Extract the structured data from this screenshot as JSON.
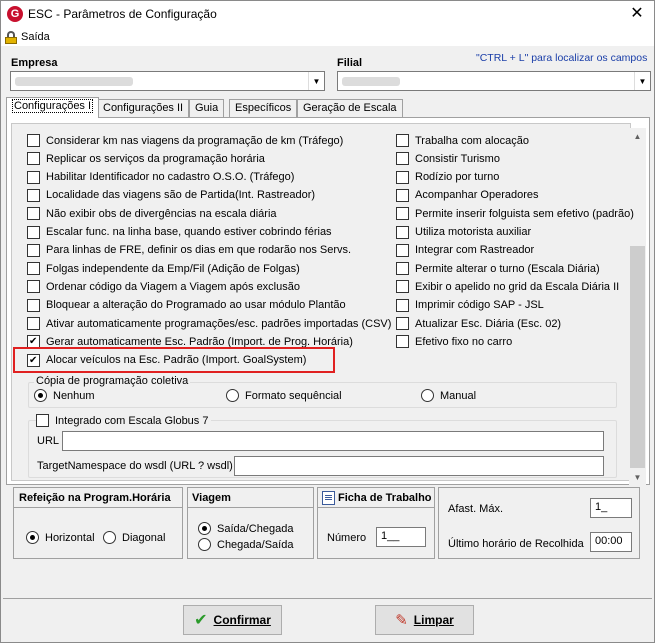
{
  "window": {
    "title": "ESC - Parâmetros de Configuração",
    "logo_letter": "G",
    "close_glyph": "✕"
  },
  "menu": {
    "sair": "Saída"
  },
  "empresa": {
    "label": "Empresa"
  },
  "filial": {
    "label": "Filial"
  },
  "hint": "\"CTRL + L\" para localizar os campos",
  "tabs": [
    {
      "label": "Configurações I"
    },
    {
      "label": "Configurações II"
    },
    {
      "label": "Guia"
    },
    {
      "label": "Específicos"
    },
    {
      "label": "Geração de Escala"
    }
  ],
  "left_options": [
    {
      "label": "Considerar km nas viagens da programação de km (Tráfego)",
      "checked": false
    },
    {
      "label": "Replicar os serviços da programação horária",
      "checked": false
    },
    {
      "label": "Habilitar Identificador no cadastro O.S.O. (Tráfego)",
      "checked": false
    },
    {
      "label": "Localidade das viagens são de Partida(Int. Rastreador)",
      "checked": false
    },
    {
      "label": "Não exibir obs de divergências na escala diária",
      "checked": false
    },
    {
      "label": "Escalar func. na linha base, quando estiver cobrindo férias",
      "checked": false
    },
    {
      "label": "Para linhas de FRE, definir os dias em que rodarão nos Servs.",
      "checked": false
    },
    {
      "label": "Folgas independente da Emp/Fil (Adição de Folgas)",
      "checked": false
    },
    {
      "label": "Ordenar código da Viagem a Viagem após exclusão",
      "checked": false
    },
    {
      "label": "Bloquear a alteração do Programado ao usar módulo Plantão",
      "checked": false
    },
    {
      "label": "Ativar automaticamente programações/esc. padrões importadas (CSV)",
      "checked": false
    },
    {
      "label": "Gerar automaticamente Esc. Padrão (Import. de Prog. Horária)",
      "checked": true
    },
    {
      "label": "Alocar veículos na Esc. Padrão (Import. GoalSystem)",
      "checked": true
    }
  ],
  "right_options": [
    {
      "label": "Trabalha com alocação",
      "checked": false
    },
    {
      "label": "Consistir Turismo",
      "checked": false
    },
    {
      "label": "Rodízio por turno",
      "checked": false
    },
    {
      "label": "Acompanhar Operadores",
      "checked": false
    },
    {
      "label": "Permite inserir folguista sem efetivo (padrão)",
      "checked": false
    },
    {
      "label": "Utiliza motorista auxiliar",
      "checked": false
    },
    {
      "label": "Integrar com Rastreador",
      "checked": false
    },
    {
      "label": "Permite alterar o turno (Escala Diária)",
      "checked": false
    },
    {
      "label": "Exibir o apelido no grid da Escala Diária II",
      "checked": false
    },
    {
      "label": "Imprimir código SAP - JSL",
      "checked": false
    },
    {
      "label": "Atualizar Esc. Diária (Esc. 02)",
      "checked": false
    },
    {
      "label": "Efetivo fixo no carro",
      "checked": false
    }
  ],
  "copia": {
    "title": "Cópia de programação coletiva",
    "options": [
      "Nenhum",
      "Formato sequêncial",
      "Manual"
    ],
    "selected": "Nenhum"
  },
  "globus": {
    "title": "Integrado com Escala Globus 7",
    "checked": false,
    "url_label": "URL",
    "url_value": "",
    "ns_label": "TargetNamespace do wsdl (URL ? wsdl)",
    "ns_value": ""
  },
  "refeicao": {
    "title": "Refeição na Program.Horária",
    "options": [
      "Horizontal",
      "Diagonal"
    ],
    "selected": "Horizontal"
  },
  "viagem": {
    "title": "Viagem",
    "options": [
      "Saída/Chegada",
      "Chegada/Saída"
    ],
    "selected": "Saída/Chegada"
  },
  "ficha": {
    "title": "Ficha de Trabalho",
    "numero_label": "Número",
    "numero_value": "1__"
  },
  "afast": {
    "afast_label": "Afast. Máx.",
    "afast_value": "1_",
    "recolhida_label": "Último horário de Recolhida",
    "recolhida_value": "00:00"
  },
  "buttons": {
    "confirmar": "Confirmar",
    "limpar": "Limpar"
  }
}
